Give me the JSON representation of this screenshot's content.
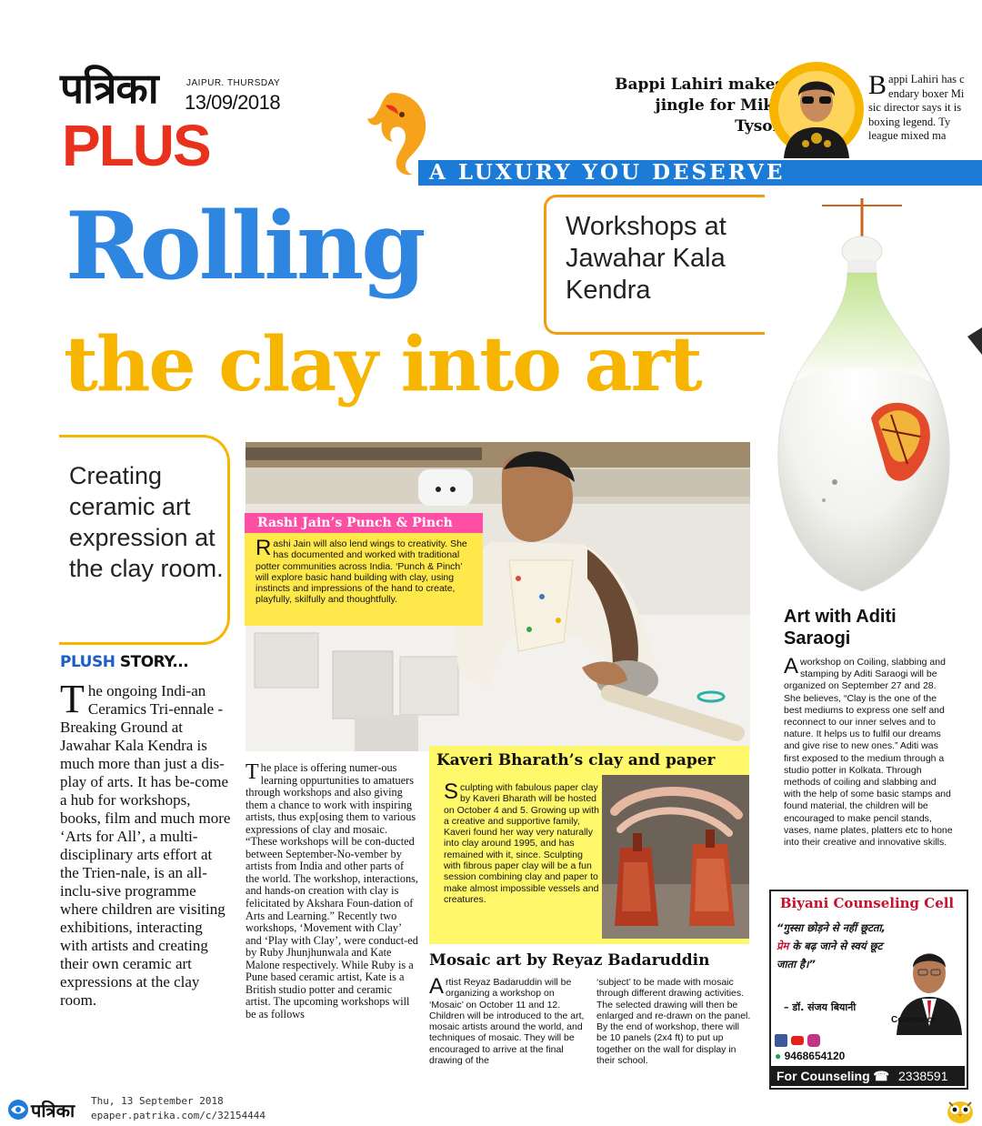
{
  "masthead": {
    "logo_hindi": "पत्रिका",
    "dateline": "JAIPUR. THURSDAY",
    "date": "13/09/2018",
    "section": "PLUS",
    "tagline": "A LUXURY YOU DESERVE"
  },
  "teaser": {
    "headline": "Bappi Lahiri makes jingle for Mike Tyson",
    "body_lines": [
      "appi Lahiri has c",
      "endary boxer Mi",
      "sic director says it is",
      "boxing legend. Ty",
      "league mixed ma"
    ],
    "drop_cap": "B"
  },
  "headline": {
    "line1": "Rolling",
    "line2": "the clay into art"
  },
  "deck": "Workshops at Jawahar Kala Kendra",
  "standfirst": "Creating ceramic art expression at the clay room.",
  "story_label": {
    "part1": "PLUSH",
    "part2": "STORY..."
  },
  "story": {
    "drop_cap": "T",
    "text": "he ongoing Indi-an Ceramics Tri-ennale - Breaking Ground at Jawahar Kala Kendra is much more than just a dis-play of arts. It has be-come a hub for workshops, books, film and much more ‘Arts for All’, a multi-disciplinary arts effort at the Trien-nale,  is an all-inclu-sive programme where children are visiting exhibitions, interacting with artists and creating their own ceramic art expressions at the clay room."
  },
  "rashi": {
    "heading": "Rashi Jain’s Punch & Pinch",
    "drop_cap": "R",
    "text": "ashi Jain will also lend wings to creativity. She has documented and worked with traditional potter communities across India. ‘Punch & Pinch’  will explore basic hand building with clay, using instincts and impressions of the hand to create, playfully, skilfully and thoughtfully."
  },
  "middle": {
    "drop_cap": "T",
    "text": "he place is offering numer-ous learning oppurtunities to amatuers through workshops and also giving them a chance to work with inspiring artists, thus exp[osing them to various expressions of clay and mosaic. “These workshops will be con-ducted between September-No-vember by artists from India and other parts of the world. The workshop, interactions, and hands-on creation with clay is felicitated by Akshara Foun-dation of Arts and Learning.” Recently   two   workshops, ‘Movement with Clay’ and ‘Play with Clay’, were conduct-ed by Ruby Jhunjhunwala and Kate Malone respectively. While Ruby is a Pune based ceramic artist, Kate is a British studio potter and ceramic artist. The upcoming workshops will be as follows"
  },
  "kaveri": {
    "heading": "Kaveri Bharath’s clay and paper",
    "drop_cap": "S",
    "text": "culpting with fabulous paper clay by Kaveri Bharath will be hosted on October 4 and 5. Growing up with a creative and supportive family, Kaveri found her way very naturally into clay around 1995, and has remained with it, since. Sculpting with fibrous paper clay will be a fun session combining clay and paper to make almost impossible vessels and creatures."
  },
  "mosaic": {
    "heading": "Mosaic art by Reyaz Badaruddin",
    "drop_cap": "A",
    "col1": "rtist Reyaz Badaruddin will be organizing a workshop on ‘Mosaic’ on October 11 and 12. Children will be introduced to the art, mosaic artists around the world, and techniques of mosaic. They will be encouraged to arrive at the final drawing of the",
    "col2": "‘subject’ to be made with mosaic through different drawing activities. The selected drawing will then be enlarged and re-drawn on the panel. By the end of workshop, there will be 10 panels (2x4 ft) to put up together on the wall for display in their school."
  },
  "aditi": {
    "heading": "Art with Aditi Saraogi",
    "drop_cap": "A",
    "text": " workshop on Coiling, slabbing and stamping by Aditi Saraogi will be organized on September 27 and 28. She believes, “Clay is the one of the best mediums to express one self and reconnect to our inner selves and to nature. It helps us to fulfil our dreams and give rise to new ones.” Aditi was first exposed to the medium through a studio potter in Kolkata. Through methods of coiling and slabbing and with the help of some basic stamps and found material, the children will be encouraged to make pencil stands, vases, name plates, platters etc to hone into their creative and innovative skills."
  },
  "ad": {
    "title": "Biyani Counseling Cell",
    "quote_a": "“गुस्सा छोड़ने से नहीं छूटता, ",
    "quote_em": "प्रेम",
    "quote_b": " के बढ़ जाने से स्वयं छूट जाता है।”",
    "signature": "– डॉ. संजय बियानी",
    "role": "Counselor",
    "phone": "9468654120",
    "cta": "For Counseling ☎",
    "cta_number": "2338591"
  },
  "footer": {
    "logo": "पत्रिका",
    "date": "Thu, 13 September 2018",
    "url": "epaper.patrika.com/c/32154444"
  }
}
